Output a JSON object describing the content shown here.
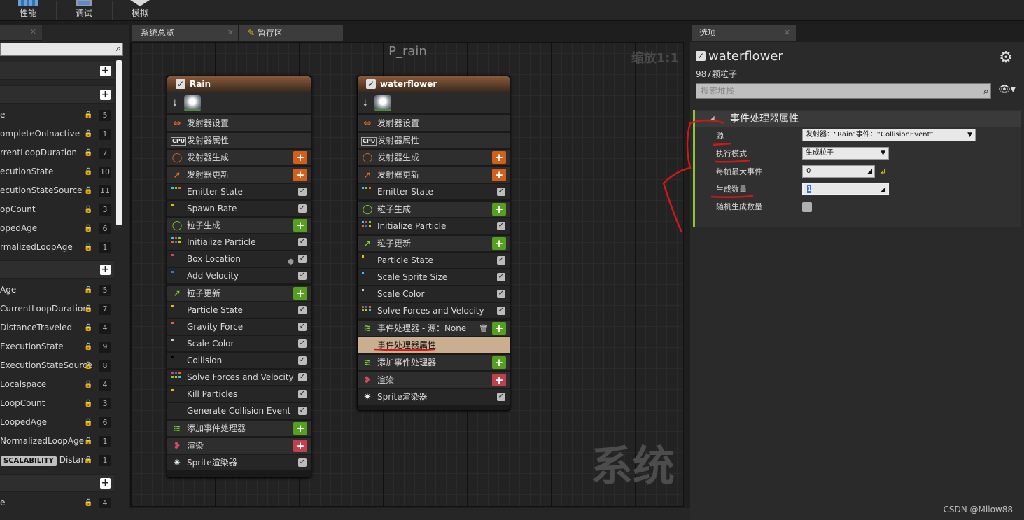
{
  "toolbar": {
    "items": [
      {
        "label": "性能",
        "icon": "performance-icon"
      },
      {
        "label": "调试",
        "icon": "debug-icon"
      },
      {
        "label": "模拟",
        "icon": "simulate-icon"
      }
    ]
  },
  "left_panel": {
    "rows_group1": [
      {
        "label": "e",
        "value": "5"
      },
      {
        "label": "ompleteOnInactive",
        "value": "1"
      },
      {
        "label": "rrentLoopDuration",
        "value": "7"
      },
      {
        "label": "ecutionState",
        "value": "10"
      },
      {
        "label": "ecutionStateSource",
        "value": "11"
      },
      {
        "label": "opCount",
        "value": "3"
      },
      {
        "label": "opedAge",
        "value": "6"
      },
      {
        "label": "rmalizedLoopAge",
        "value": "1"
      }
    ],
    "rows_group2": [
      {
        "label": "Age",
        "value": "5"
      },
      {
        "label": "CurrentLoopDuration",
        "value": "7"
      },
      {
        "label": "DistanceTraveled",
        "value": "4"
      },
      {
        "label": "ExecutionState",
        "value": "9"
      },
      {
        "label": "ExecutionStateSource",
        "value": "8"
      },
      {
        "label": "Localspace",
        "value": "4"
      },
      {
        "label": "LoopCount",
        "value": "3"
      },
      {
        "label": "LoopedAge",
        "value": "6"
      },
      {
        "label": "NormalizedLoopAge",
        "value": "1"
      },
      {
        "label": "Distan",
        "value": "1",
        "badge": "SCALABILITY"
      }
    ],
    "rows_group3": [
      {
        "label": "e",
        "value": "4"
      }
    ]
  },
  "tabs": {
    "overview": "系统总览",
    "scratch": "暂存区",
    "details": "选项"
  },
  "graph": {
    "title": "P_rain",
    "zoom": "缩放1:1",
    "watermark": "系统"
  },
  "node_rain": {
    "title": "Rain",
    "rows": [
      {
        "label": "发射器设置"
      },
      {
        "label": "发射器属性"
      },
      {
        "label": "发射器生成"
      },
      {
        "label": "发射器更新"
      },
      {
        "label": "Emitter State"
      },
      {
        "label": "Spawn Rate"
      },
      {
        "label": "粒子生成"
      },
      {
        "label": "Initialize Particle"
      },
      {
        "label": "Box Location"
      },
      {
        "label": "Add Velocity"
      },
      {
        "label": "粒子更新"
      },
      {
        "label": "Particle State"
      },
      {
        "label": "Gravity Force"
      },
      {
        "label": "Scale Color"
      },
      {
        "label": "Collision"
      },
      {
        "label": "Solve Forces and Velocity"
      },
      {
        "label": "Kill Particles"
      },
      {
        "label": "Generate Collision Event"
      },
      {
        "label": "添加事件处理器"
      },
      {
        "label": "渲染"
      },
      {
        "label": "Sprite渲染器"
      }
    ]
  },
  "node_water": {
    "title": "waterflower",
    "rows": [
      {
        "label": "发射器设置"
      },
      {
        "label": "发射器属性"
      },
      {
        "label": "发射器生成"
      },
      {
        "label": "发射器更新"
      },
      {
        "label": "Emitter State"
      },
      {
        "label": "粒子生成"
      },
      {
        "label": "Initialize Particle"
      },
      {
        "label": "粒子更新"
      },
      {
        "label": "Particle State"
      },
      {
        "label": "Scale Sprite Size"
      },
      {
        "label": "Scale Color"
      },
      {
        "label": "Solve Forces and Velocity"
      },
      {
        "label": "事件处理器 - 源：None"
      },
      {
        "label": "事件处理器属性"
      },
      {
        "label": "添加事件处理器"
      },
      {
        "label": "渲染"
      },
      {
        "label": "Sprite渲染器"
      }
    ]
  },
  "details": {
    "emitter_name": "waterflower",
    "particle_count": "987颗粒子",
    "search_placeholder": "搜索堆栈",
    "section_title": "事件处理器属性",
    "props": {
      "source_label": "源",
      "source_value": "发射器：“Rain”事件：“CollisionEvent”",
      "mode_label": "执行模式",
      "mode_value": "生成粒子",
      "max_events_label": "每帧最大事件",
      "max_events_value": "0",
      "spawn_count_label": "生成数量",
      "spawn_count_value": "1",
      "random_spawn_label": "随机生成数量"
    }
  },
  "watermark_site": "CSDN @Milow88",
  "colors": {
    "emitter_header": "#8a5a3a",
    "add_orange": "#d2601a",
    "add_green": "#55a01e",
    "add_red": "#c0404e",
    "highlight_row": "#c9ae90",
    "section_accent": "#8ac53c",
    "annotation_red": "#d01818"
  }
}
